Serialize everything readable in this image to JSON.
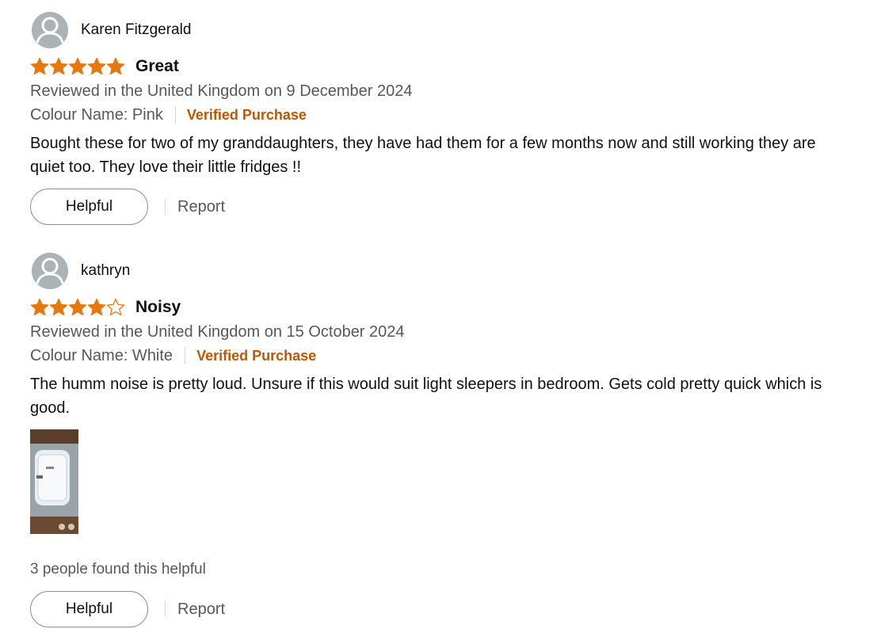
{
  "reviews": [
    {
      "profile_name": "Karen Fitzgerald",
      "rating": 5,
      "rating_max": 5,
      "title": "Great",
      "date_line": "Reviewed in the United Kingdom on 9 December 2024",
      "variant": "Colour Name: Pink",
      "verified": "Verified Purchase",
      "body": "Bought these for two of my granddaughters, they have had them for a few months now and still working they are quiet too. They love their little fridges !!",
      "helpful_label": "Helpful",
      "report_label": "Report"
    },
    {
      "profile_name": "kathryn",
      "rating": 4,
      "rating_max": 5,
      "title": "Noisy",
      "date_line": "Reviewed in the United Kingdom on 15 October 2024",
      "variant": "Colour Name: White",
      "verified": "Verified Purchase",
      "body": "The humm noise is pretty loud. Unsure if this would suit light sleepers in bedroom. Gets cold pretty quick which is good.",
      "helpful_count": "3 people found this helpful",
      "helpful_label": "Helpful",
      "report_label": "Report"
    }
  ],
  "colors": {
    "star": "#e47911",
    "verified": "#c45500",
    "meta_text": "#565959",
    "avatar_bg": "#a9b3b8"
  },
  "icons": {
    "avatar": "default-user-avatar-icon",
    "star_full": "star-filled-icon",
    "star_empty": "star-outline-icon"
  }
}
